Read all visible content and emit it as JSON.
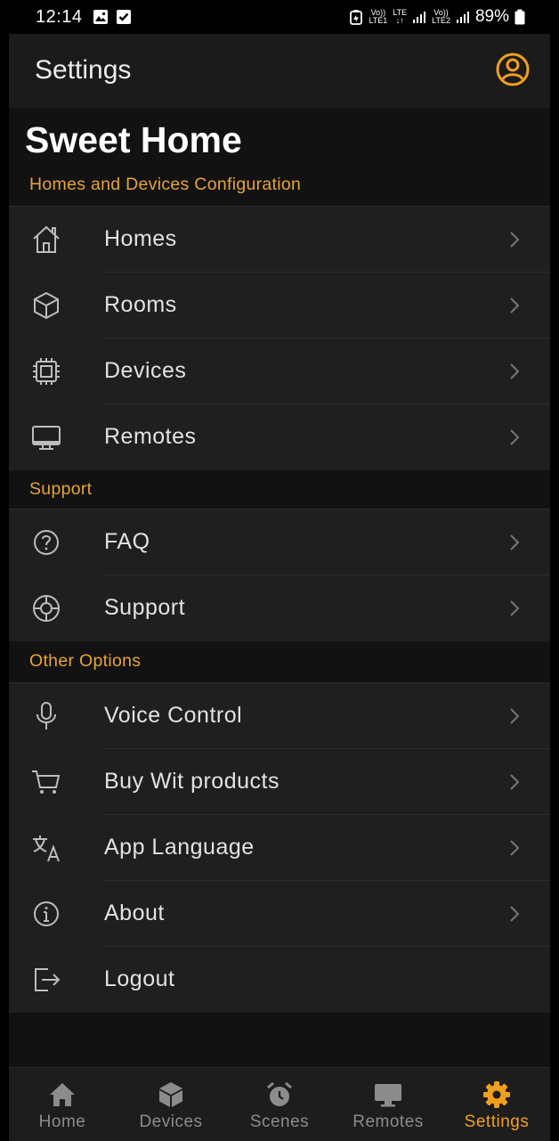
{
  "status_bar": {
    "time": "12:14",
    "lte1_top": "Vo))",
    "lte1_bottom": "LTE1",
    "lte_mid": "LTE",
    "lte2_top": "Vo))",
    "lte2_bottom": "LTE2",
    "battery": "89%"
  },
  "header": {
    "title": "Settings",
    "profile_icon": "account-circle-icon"
  },
  "home_name": "Sweet Home",
  "sections": {
    "config": {
      "label": "Homes and Devices Configuration",
      "items": [
        {
          "label": "Homes",
          "icon": "home-icon"
        },
        {
          "label": "Rooms",
          "icon": "cube-icon"
        },
        {
          "label": "Devices",
          "icon": "chip-icon"
        },
        {
          "label": "Remotes",
          "icon": "monitor-icon"
        }
      ]
    },
    "support": {
      "label": "Support",
      "items": [
        {
          "label": "FAQ",
          "icon": "question-icon"
        },
        {
          "label": "Support",
          "icon": "lifebuoy-icon"
        }
      ]
    },
    "other": {
      "label": "Other Options",
      "items": [
        {
          "label": "Voice Control",
          "icon": "microphone-icon"
        },
        {
          "label": "Buy Wit products",
          "icon": "cart-icon"
        },
        {
          "label": "App Language",
          "icon": "translate-icon"
        },
        {
          "label": "About",
          "icon": "info-icon"
        },
        {
          "label": "Logout",
          "icon": "logout-icon"
        }
      ]
    }
  },
  "bottom_nav": {
    "items": [
      {
        "label": "Home",
        "icon": "home-icon"
      },
      {
        "label": "Devices",
        "icon": "cube-icon"
      },
      {
        "label": "Scenes",
        "icon": "alarm-clock-icon"
      },
      {
        "label": "Remotes",
        "icon": "monitor-icon"
      },
      {
        "label": "Settings",
        "icon": "gear-icon"
      }
    ],
    "active_index": 4
  },
  "colors": {
    "accent": "#f0a020",
    "section_label": "#e8a33a",
    "background": "#121212",
    "row_background": "#1f1f1f"
  }
}
